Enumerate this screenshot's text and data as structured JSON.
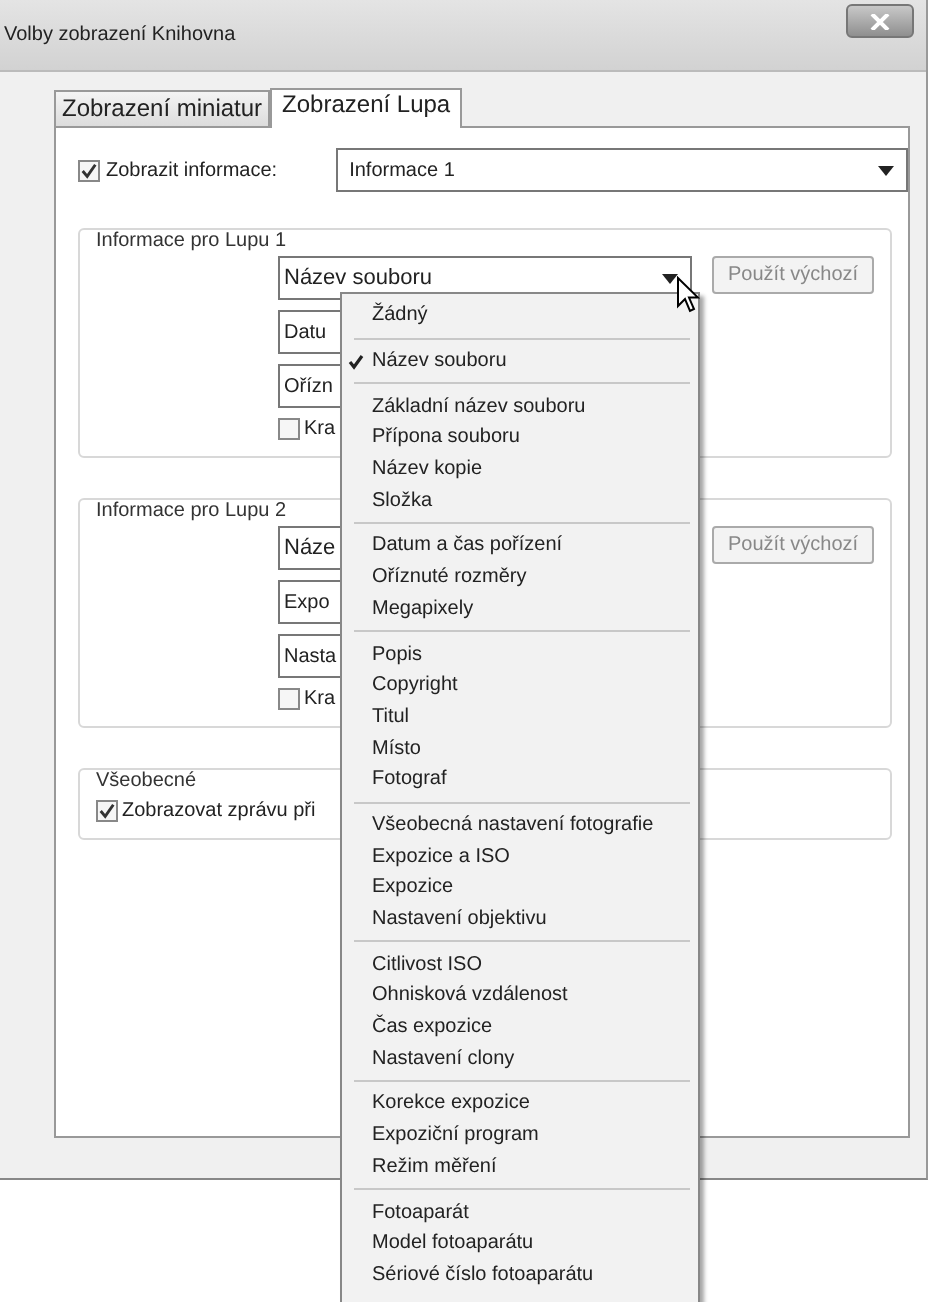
{
  "window": {
    "title": "Volby zobrazení Knihovna"
  },
  "tabs": [
    {
      "label": "Zobrazení miniatur",
      "selected": false
    },
    {
      "label": "Zobrazení Lupa",
      "selected": true
    }
  ],
  "show_info": {
    "label": "Zobrazit informace:",
    "checked": true,
    "value": "Informace 1"
  },
  "groups": [
    {
      "title": "Informace pro Lupu 1",
      "select": "Název souboru",
      "fields": [
        "Datu",
        "Ořízn"
      ],
      "checkbox": {
        "label": "Kra",
        "checked": false
      },
      "button": "Použít výchozí"
    },
    {
      "title": "Informace pro Lupu 2",
      "select": "Náze",
      "fields": [
        "Expo",
        "Nasta"
      ],
      "checkbox": {
        "label": "Kra",
        "checked": false
      },
      "button": "Použít výchozí"
    }
  ],
  "general": {
    "title": "Všeobecné",
    "checkbox": {
      "label": "Zobrazovat zprávu při",
      "checked": true
    }
  },
  "menu": {
    "sections": [
      {
        "items": [
          {
            "label": "Žádný",
            "checked": false
          }
        ]
      },
      {
        "items": [
          {
            "label": "Název souboru",
            "checked": true
          }
        ]
      },
      {
        "items": [
          {
            "label": "Základní název souboru",
            "checked": false
          },
          {
            "label": "Přípona souboru",
            "checked": false
          },
          {
            "label": "Název kopie",
            "checked": false
          },
          {
            "label": "Složka",
            "checked": false
          }
        ]
      },
      {
        "items": [
          {
            "label": "Datum a čas pořízení",
            "checked": false
          },
          {
            "label": "Oříznuté rozměry",
            "checked": false
          },
          {
            "label": "Megapixely",
            "checked": false
          }
        ]
      },
      {
        "items": [
          {
            "label": "Popis",
            "checked": false
          },
          {
            "label": "Copyright",
            "checked": false
          },
          {
            "label": "Titul",
            "checked": false
          },
          {
            "label": "Místo",
            "checked": false
          },
          {
            "label": "Fotograf",
            "checked": false
          }
        ]
      },
      {
        "items": [
          {
            "label": "Všeobecná nastavení fotografie",
            "checked": false
          },
          {
            "label": "Expozice a ISO",
            "checked": false
          },
          {
            "label": "Expozice",
            "checked": false
          },
          {
            "label": "Nastavení objektivu",
            "checked": false
          }
        ]
      },
      {
        "items": [
          {
            "label": "Citlivost ISO",
            "checked": false
          },
          {
            "label": "Ohnisková vzdálenost",
            "checked": false
          },
          {
            "label": "Čas expozice",
            "checked": false
          },
          {
            "label": "Nastavení clony",
            "checked": false
          }
        ]
      },
      {
        "items": [
          {
            "label": "Korekce expozice",
            "checked": false
          },
          {
            "label": "Expoziční program",
            "checked": false
          },
          {
            "label": "Režim měření",
            "checked": false
          }
        ]
      },
      {
        "items": [
          {
            "label": "Fotoaparát",
            "checked": false
          },
          {
            "label": "Model fotoaparátu",
            "checked": false
          },
          {
            "label": "Sériové číslo fotoaparátu",
            "checked": false
          }
        ]
      }
    ]
  }
}
